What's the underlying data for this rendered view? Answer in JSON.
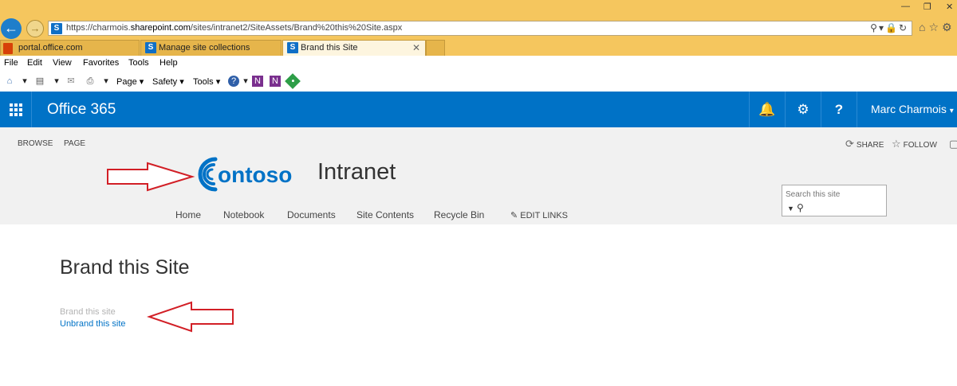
{
  "browser": {
    "url_prefix": "https://charmois.",
    "url_host": "sharepoint.com",
    "url_path": "/sites/intranet2/SiteAssets/Brand%20this%20Site.aspx",
    "tabs": [
      {
        "label": "portal.office.com",
        "active": false
      },
      {
        "label": "Manage site collections",
        "active": false
      },
      {
        "label": "Brand this Site",
        "active": true
      }
    ],
    "menu": [
      "File",
      "Edit",
      "View",
      "Favorites",
      "Tools",
      "Help"
    ],
    "commands": {
      "page": "Page",
      "safety": "Safety",
      "tools": "Tools"
    },
    "chrome_color": "#f5c65e"
  },
  "suite_bar": {
    "title": "Office 365",
    "user": "Marc Charmois",
    "color": "#0072c6"
  },
  "ribbon": {
    "tabs": [
      "BROWSE",
      "PAGE"
    ],
    "share": "SHARE",
    "follow": "FOLLOW"
  },
  "site": {
    "logo_text": "ontoso",
    "title": "Intranet",
    "nav": [
      "Home",
      "Notebook",
      "Documents",
      "Site Contents",
      "Recycle Bin"
    ],
    "edit_links": "EDIT LINKS",
    "search_placeholder": "Search this site"
  },
  "content": {
    "page_title": "Brand this Site",
    "brand_link": "Brand this site",
    "unbrand_link": "Unbrand this site"
  }
}
